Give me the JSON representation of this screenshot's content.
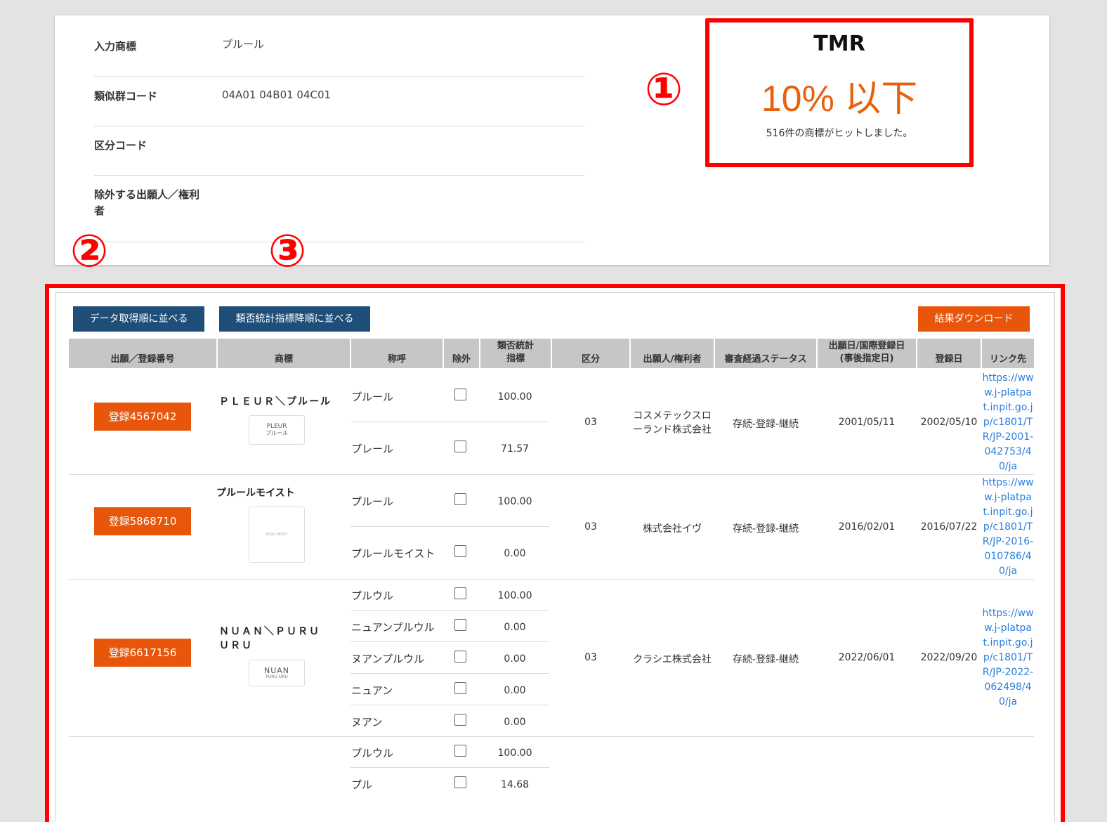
{
  "search_info": {
    "rows": [
      {
        "label": "入力商標",
        "value": "プルール"
      },
      {
        "label": "類似群コード",
        "value": "04A01 04B01 04C01"
      },
      {
        "label": "区分コード",
        "value": ""
      },
      {
        "label": "除外する出願人／権利者",
        "value": ""
      }
    ]
  },
  "tmr": {
    "title": "TMR",
    "value": "10% 以下",
    "hits": "516件の商標がヒットしました。"
  },
  "annotations": [
    "①",
    "②",
    "③"
  ],
  "toolbar": {
    "sort_by_date": "データ取得順に並べる",
    "sort_by_similarity": "類否統計指標降順に並べる",
    "download": "結果ダウンロード"
  },
  "table": {
    "headers": {
      "number": "出願／登録番号",
      "mark": "商標",
      "call": "称呼",
      "exclude": "除外",
      "score_line1": "類否統計",
      "score_line2": "指標",
      "class": "区分",
      "owner": "出願人/権利者",
      "status": "審査経過ステータス",
      "date_line1": "出願日/国際登録日",
      "date_line2": "(事後指定日)",
      "reg_date": "登録日",
      "link": "リンク先"
    },
    "rows": [
      {
        "number": "登録4567042",
        "mark": "ＰＬＥＵＲ＼プルール",
        "mark_img_line1": "PLEUR",
        "mark_img_line2": "プルール",
        "calls": [
          {
            "call": "プルール",
            "score": "100.00",
            "excluded": false
          },
          {
            "call": "プレール",
            "score": "71.57",
            "excluded": false
          }
        ],
        "class": "03",
        "owner": "コスメテックスローランド株式会社",
        "status": "存続-登録-継続",
        "filing_date": "2001/05/11",
        "reg_date": "2002/05/10",
        "link": "https://www.j-platpat.inpit.go.jp/c1801/TR/JP-2001-042753/40/ja"
      },
      {
        "number": "登録5868710",
        "mark": "プルールモイスト",
        "mark_img_line1": "PURU MOIST",
        "mark_img_line2": "",
        "calls": [
          {
            "call": "プルール",
            "score": "100.00",
            "excluded": false
          },
          {
            "call": "プルールモイスト",
            "score": "0.00",
            "excluded": false
          }
        ],
        "class": "03",
        "owner": "株式会社イヴ",
        "status": "存続-登録-継続",
        "filing_date": "2016/02/01",
        "reg_date": "2016/07/22",
        "link": "https://www.j-platpat.inpit.go.jp/c1801/TR/JP-2016-010786/40/ja"
      },
      {
        "number": "登録6617156",
        "mark": "ＮＵＡＮ＼ＰＵＲＵ　ＵＲＵ",
        "mark_img_line1": "NUAN",
        "mark_img_line2": "PURU URU",
        "calls": [
          {
            "call": "プルウル",
            "score": "100.00",
            "excluded": false
          },
          {
            "call": "ニュアンプルウル",
            "score": "0.00",
            "excluded": false
          },
          {
            "call": "ヌアンプルウル",
            "score": "0.00",
            "excluded": false
          },
          {
            "call": "ニュアン",
            "score": "0.00",
            "excluded": false
          },
          {
            "call": "ヌアン",
            "score": "0.00",
            "excluded": false
          }
        ],
        "class": "03",
        "owner": "クラシエ株式会社",
        "status": "存続-登録-継続",
        "filing_date": "2022/06/01",
        "reg_date": "2022/09/20",
        "link": "https://www.j-platpat.inpit.go.jp/c1801/TR/JP-2022-062498/40/ja"
      },
      {
        "calls": [
          {
            "call": "プルウル",
            "score": "100.00",
            "excluded": false
          },
          {
            "call": "プル",
            "score": "14.68",
            "excluded": false
          }
        ]
      }
    ]
  }
}
